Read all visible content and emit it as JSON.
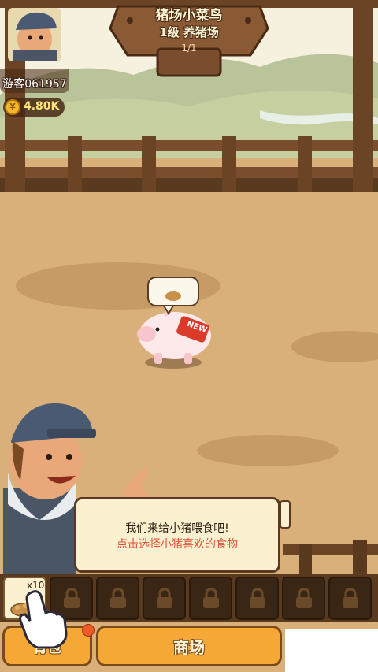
{
  "player": {
    "name": "游客061957",
    "coins": "4.80K"
  },
  "sign": {
    "title": "猪场小菜鸟",
    "level": "1级 养猪场",
    "progress": "1/1"
  },
  "pig": {
    "badge": "NEW"
  },
  "dialog": {
    "line1": "我们来给小猪喂食吧!",
    "line2": "点击选择小猪喜欢的食物"
  },
  "inventory": {
    "food_count": "x10",
    "locked_slots": 7
  },
  "buttons": {
    "bag": "背包",
    "shop": "商场"
  },
  "colors": {
    "accent": "#f6a836",
    "hint": "#e2503a",
    "wood": "#6b4426"
  },
  "icons": [
    "coin-icon",
    "lock-icon",
    "food-icon",
    "hand-pointer-icon",
    "thought-bubble-icon"
  ]
}
